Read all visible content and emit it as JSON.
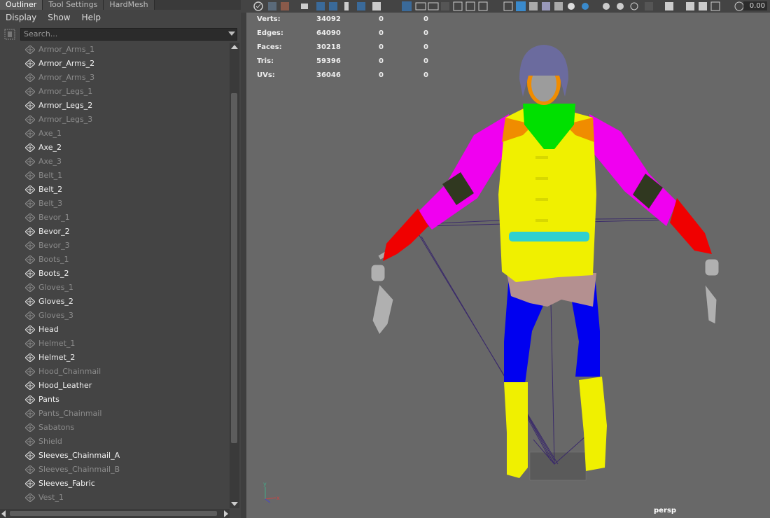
{
  "tabs": [
    "Outliner",
    "Tool Settings",
    "HardMesh"
  ],
  "menu": [
    "Display",
    "Show",
    "Help"
  ],
  "search": {
    "placeholder": "Search..."
  },
  "outliner_items": [
    {
      "name": "Armor_Arms_1",
      "visible": false
    },
    {
      "name": "Armor_Arms_2",
      "visible": true
    },
    {
      "name": "Armor_Arms_3",
      "visible": false
    },
    {
      "name": "Armor_Legs_1",
      "visible": false
    },
    {
      "name": "Armor_Legs_2",
      "visible": true
    },
    {
      "name": "Armor_Legs_3",
      "visible": false
    },
    {
      "name": "Axe_1",
      "visible": false
    },
    {
      "name": "Axe_2",
      "visible": true
    },
    {
      "name": "Axe_3",
      "visible": false
    },
    {
      "name": "Belt_1",
      "visible": false
    },
    {
      "name": "Belt_2",
      "visible": true
    },
    {
      "name": "Belt_3",
      "visible": false
    },
    {
      "name": "Bevor_1",
      "visible": false
    },
    {
      "name": "Bevor_2",
      "visible": true
    },
    {
      "name": "Bevor_3",
      "visible": false
    },
    {
      "name": "Boots_1",
      "visible": false
    },
    {
      "name": "Boots_2",
      "visible": true
    },
    {
      "name": "Gloves_1",
      "visible": false
    },
    {
      "name": "Gloves_2",
      "visible": true
    },
    {
      "name": "Gloves_3",
      "visible": false
    },
    {
      "name": "Head",
      "visible": true
    },
    {
      "name": "Helmet_1",
      "visible": false
    },
    {
      "name": "Helmet_2",
      "visible": true
    },
    {
      "name": "Hood_Chainmail",
      "visible": false
    },
    {
      "name": "Hood_Leather",
      "visible": true
    },
    {
      "name": "Pants",
      "visible": true
    },
    {
      "name": "Pants_Chainmail",
      "visible": false
    },
    {
      "name": "Sabatons",
      "visible": false
    },
    {
      "name": "Shield",
      "visible": false
    },
    {
      "name": "Sleeves_Chainmail_A",
      "visible": true
    },
    {
      "name": "Sleeves_Chainmail_B",
      "visible": false
    },
    {
      "name": "Sleeves_Fabric",
      "visible": true
    },
    {
      "name": "Vest_1",
      "visible": false
    }
  ],
  "toolbar": {
    "value": "0.00"
  },
  "hud": {
    "rows": [
      {
        "label": "Verts:",
        "v1": "34092",
        "v2": "0",
        "v3": "0"
      },
      {
        "label": "Edges:",
        "v1": "64090",
        "v2": "0",
        "v3": "0"
      },
      {
        "label": "Faces:",
        "v1": "30218",
        "v2": "0",
        "v3": "0"
      },
      {
        "label": "Tris:",
        "v1": "59396",
        "v2": "0",
        "v3": "0"
      },
      {
        "label": "UVs:",
        "v1": "36046",
        "v2": "0",
        "v3": "0"
      }
    ]
  },
  "viewport": {
    "camera": "persp"
  },
  "colors": {
    "helmet": "#6b6b9e",
    "skin": "#9c9c9c",
    "collar": "#f08c00",
    "neck": "#00e000",
    "vest": "#f0f000",
    "sleeves": "#f000f0",
    "bands": "#303820",
    "gloves": "#f00000",
    "belt": "#30d0d0",
    "pants_top": "#b49090",
    "pants": "#0000f0",
    "boots": "#f0f000",
    "axe": "#b0b0b0"
  }
}
